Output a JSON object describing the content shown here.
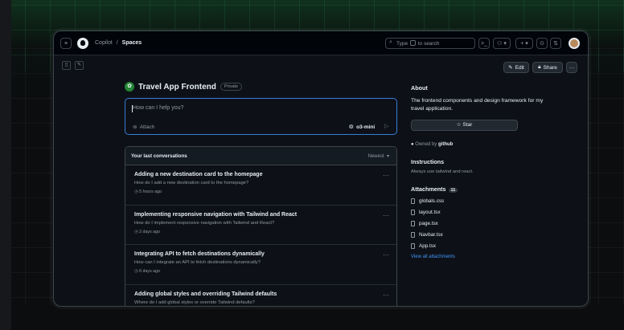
{
  "header": {
    "breadcrumb_root": "Copilot",
    "breadcrumb_sep": "/",
    "breadcrumb_current": "Spaces",
    "search_placeholder_pre": "Type",
    "search_placeholder_post": "to search",
    "cmd_label": ">_",
    "plus_label": "+"
  },
  "toolbar": {
    "edit_label": "Edit",
    "share_label": "Share",
    "more_label": "···"
  },
  "space": {
    "title": "Travel App Frontend",
    "visibility": "Private"
  },
  "prompt": {
    "placeholder": "How can I help you?",
    "attach_label": "Attach",
    "model_label": "o3-mini"
  },
  "conversations": {
    "header": "Your last conversations",
    "sort_label": "Newest",
    "items": [
      {
        "title": "Adding a new destination card to the homepage",
        "subtitle": "How do I add a new destination card to the homepage?",
        "time": "5 hours ago"
      },
      {
        "title": "Implementing responsive navigation with Tailwind and React",
        "subtitle": "How do I implement responsive navigation with Tailwind and React?",
        "time": "2 days ago"
      },
      {
        "title": "Integrating API to fetch destinations dynamically",
        "subtitle": "How can I integrate an API to fetch destinations dynamically?",
        "time": "6 days ago"
      },
      {
        "title": "Adding global styles and overriding Tailwind defaults",
        "subtitle": "Where do I add global styles or override Tailwind defaults?",
        "time": ""
      }
    ]
  },
  "about": {
    "heading": "About",
    "description": "The frontend components and design framework for my travel application.",
    "star_label": "Star",
    "owned_prefix": "Owned by",
    "owner": "github",
    "instructions_heading": "Instructions",
    "instructions_text": "Always use tailwind and react.",
    "attachments_heading": "Attachments",
    "attachments_count": "11",
    "files": [
      "globals.css",
      "layout.tsx",
      "page.tsx",
      "Navbar.tsx",
      "App.tsx"
    ],
    "view_all": "View all attachments"
  }
}
